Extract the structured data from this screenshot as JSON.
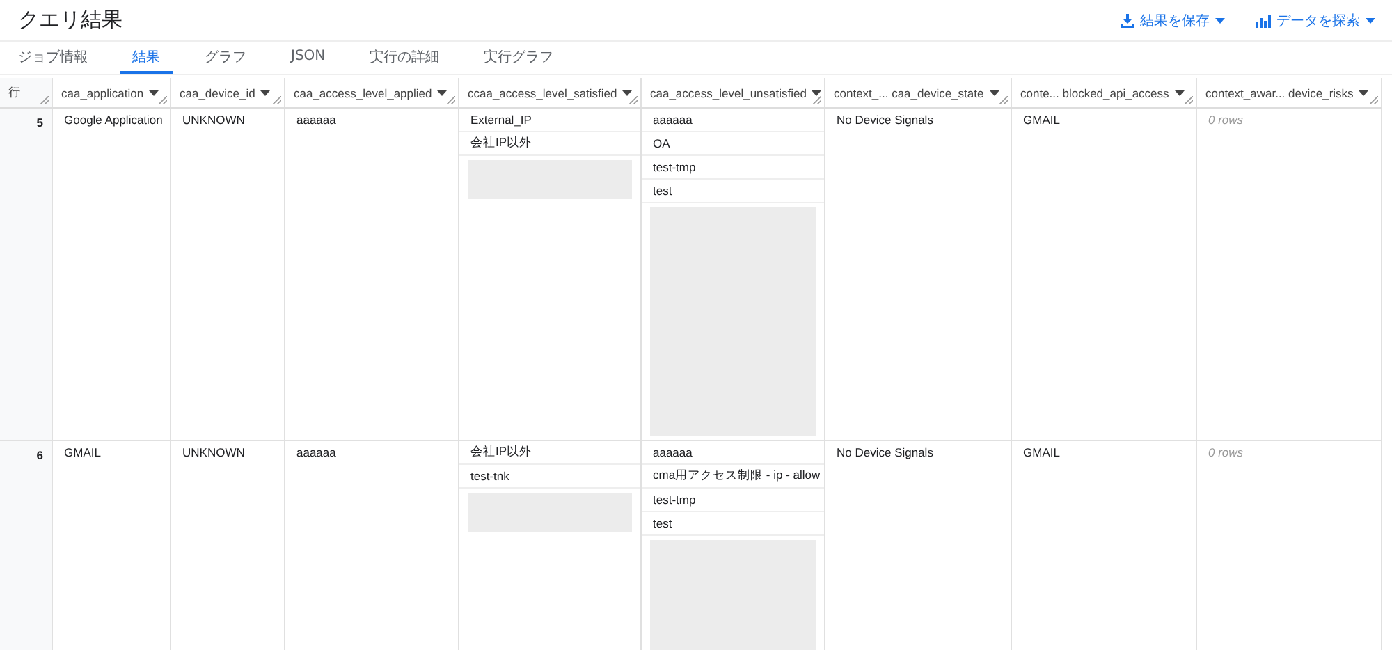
{
  "title": "クエリ結果",
  "actions": [
    {
      "kind": "save",
      "label": "結果を保存"
    },
    {
      "kind": "explore",
      "label": "データを探索"
    }
  ],
  "tabs": [
    {
      "label": "ジョブ情報",
      "selected": false
    },
    {
      "label": "結果",
      "selected": true
    },
    {
      "label": "グラフ",
      "selected": false
    },
    {
      "label": "JSON",
      "selected": false
    },
    {
      "label": "実行の詳細",
      "selected": false
    },
    {
      "label": "実行グラフ",
      "selected": false
    }
  ],
  "table": {
    "row_header": "行",
    "columns": [
      "caa_application",
      "caa_device_id",
      "caa_access_level_applied",
      "ccaa_access_level_satisfied",
      "caa_access_level_unsatisfied",
      "context_... caa_device_state",
      "conte... blocked_api_access",
      "context_awar... device_risks"
    ],
    "rows": [
      {
        "number": "5",
        "cells": [
          [
            {
              "kind": "text",
              "text": "Google Application"
            }
          ],
          [
            {
              "kind": "text",
              "text": "UNKNOWN"
            }
          ],
          [
            {
              "kind": "text",
              "text": "aaaaaa"
            }
          ],
          [
            {
              "kind": "text",
              "text": "External_IP"
            },
            {
              "kind": "text",
              "text": "会社IP以外"
            },
            {
              "kind": "redacted"
            },
            {
              "kind": "redacted"
            }
          ],
          [
            {
              "kind": "text",
              "text": "aaaaaa"
            },
            {
              "kind": "text",
              "text": "OA"
            },
            {
              "kind": "text",
              "text": "test-tmp"
            },
            {
              "kind": "text",
              "text": "test"
            },
            {
              "kind": "redacted"
            },
            {
              "kind": "redacted"
            },
            {
              "kind": "redacted"
            },
            {
              "kind": "redacted"
            },
            {
              "kind": "redacted"
            },
            {
              "kind": "redacted"
            },
            {
              "kind": "redacted"
            },
            {
              "kind": "redacted"
            },
            {
              "kind": "redacted"
            },
            {
              "kind": "redacted"
            }
          ],
          [
            {
              "kind": "text",
              "text": "No Device Signals"
            }
          ],
          [
            {
              "kind": "text",
              "text": "GMAIL"
            }
          ],
          [
            {
              "kind": "empty",
              "text": "0 rows"
            }
          ]
        ]
      },
      {
        "number": "6",
        "cells": [
          [
            {
              "kind": "text",
              "text": "GMAIL"
            }
          ],
          [
            {
              "kind": "text",
              "text": "UNKNOWN"
            }
          ],
          [
            {
              "kind": "text",
              "text": "aaaaaa"
            }
          ],
          [
            {
              "kind": "text",
              "text": "会社IP以外"
            },
            {
              "kind": "text",
              "text": "test-tnk"
            },
            {
              "kind": "redacted"
            },
            {
              "kind": "redacted"
            }
          ],
          [
            {
              "kind": "text",
              "text": "aaaaaa"
            },
            {
              "kind": "text",
              "text": "cma用アクセス制限 - ip - allow"
            },
            {
              "kind": "text",
              "text": "test-tmp"
            },
            {
              "kind": "text",
              "text": "test"
            },
            {
              "kind": "redacted"
            },
            {
              "kind": "redacted"
            },
            {
              "kind": "redacted"
            },
            {
              "kind": "redacted"
            },
            {
              "kind": "redacted"
            }
          ],
          [
            {
              "kind": "text",
              "text": "No Device Signals"
            }
          ],
          [
            {
              "kind": "text",
              "text": "GMAIL"
            }
          ],
          [
            {
              "kind": "empty",
              "text": "0 rows"
            }
          ]
        ]
      }
    ]
  }
}
